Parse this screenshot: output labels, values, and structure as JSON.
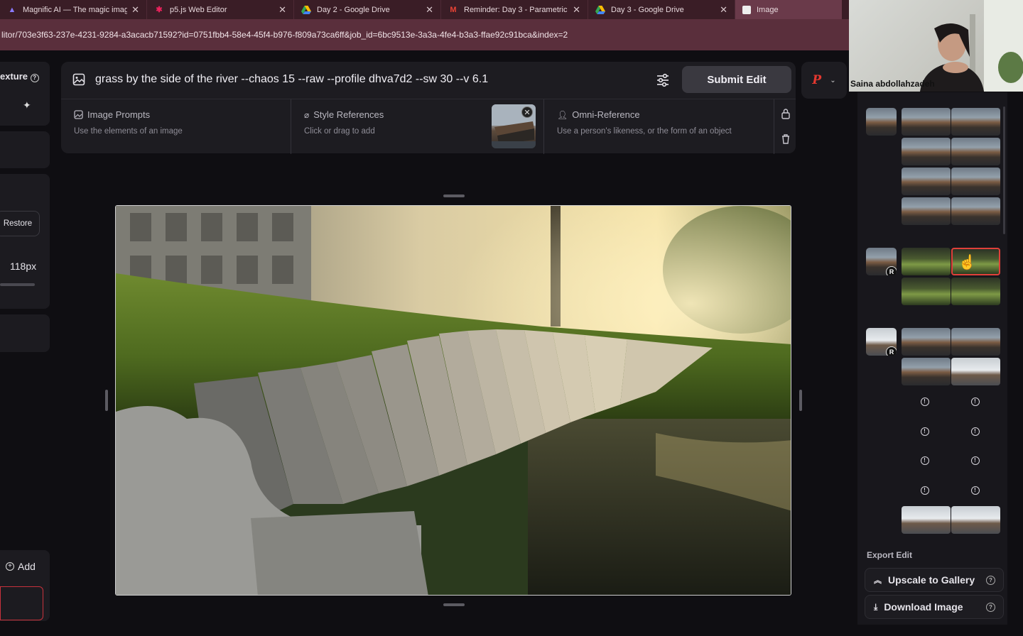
{
  "browser": {
    "tabs": [
      {
        "title": "Magnific AI — The magic imag",
        "icon": "magnific-icon"
      },
      {
        "title": "p5.js Web Editor",
        "icon": "p5js-icon"
      },
      {
        "title": "Day 2 - Google Drive",
        "icon": "google-drive-icon"
      },
      {
        "title": "Reminder: Day 3 - Parametric I",
        "icon": "gmail-icon"
      },
      {
        "title": "Day 3 - Google Drive",
        "icon": "google-drive-icon"
      },
      {
        "title": "Image",
        "icon": "image-file-icon"
      }
    ],
    "url": "litor/703e3f63-237e-4231-9284-a3acacb71592?id=0751fbb4-58e4-45f4-b976-f809a73ca6ff&job_id=6bc9513e-3a3a-4fe4-b3a3-ffae92c91bca&index=2"
  },
  "left_panel": {
    "texture_label": "exture",
    "restore_label": "Restore",
    "size_value": "118px",
    "add_label": "Add"
  },
  "prompt": {
    "text": "grass by the side of the river --chaos 15 --raw --profile dhva7d2 --sw 30 --v 6.1",
    "submit_label": "Submit Edit"
  },
  "brand": {
    "letter": "P",
    "color": "#e5382f"
  },
  "references": {
    "image_prompts": {
      "title": "Image Prompts",
      "subtitle": "Use the elements of an image"
    },
    "style_references": {
      "title": "Style References",
      "subtitle": "Click or drag to add"
    },
    "omni_reference": {
      "title": "Omni-Reference",
      "subtitle": "Use a person's likeness, or the form of an object"
    }
  },
  "right_panel": {
    "reference_badge": "R",
    "export_label": "Export Edit",
    "upscale_label": "Upscale to Gallery",
    "download_label": "Download Image"
  },
  "webcam": {
    "participant_name": "Saina abdollahzadeh"
  },
  "colors": {
    "accent_red": "#e5382f",
    "selected_border": "#e0403a",
    "panel_bg": "#1d1c21"
  }
}
